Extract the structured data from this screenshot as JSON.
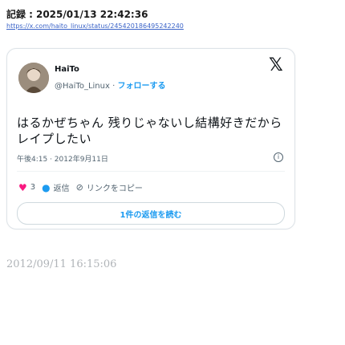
{
  "record": {
    "label": "記録 :",
    "datetime": "2025/01/13 22:42:36",
    "url": "https://x.com/haito_linux/status/245420186495242240"
  },
  "tweet": {
    "author_name": "HaiTo",
    "author_handle": "@HaiTo_Linux",
    "separator": " · ",
    "follow_label": "フォローする",
    "text": "はるかぜちゃん 残りじゃないし結構好きだからレイプしたい",
    "timestamp": "午後4:15 · 2012年9月11日",
    "info_glyph": "i",
    "likes_count": "3",
    "reply_label": "返信",
    "copy_link_label": "リンクをコピー",
    "read_replies_label": "1件の返信を読む"
  },
  "archive_stamp": "2012/09/11 16:15:06",
  "icons": {
    "x_logo": "x-logo-icon",
    "heart": "heart-icon",
    "reply": "reply-bubble-icon",
    "link": "link-icon",
    "info": "info-icon"
  },
  "colors": {
    "accent": "#1d9bf0",
    "like": "#f91880",
    "link": "#3b64c8",
    "muted": "#536471"
  }
}
